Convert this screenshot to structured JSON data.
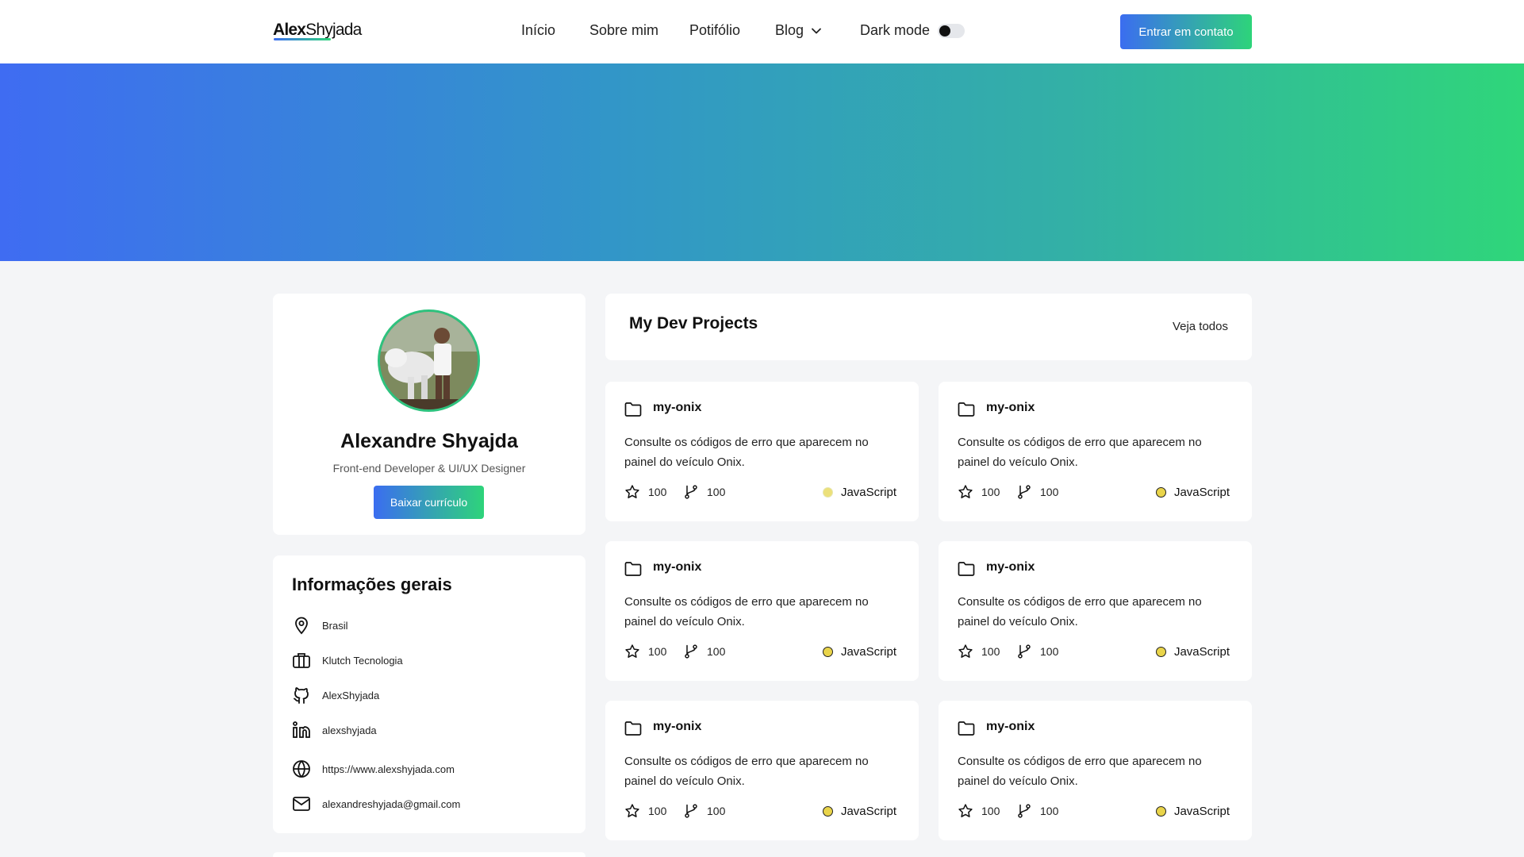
{
  "nav": {
    "logo_first": "Alex",
    "logo_last": "Shyjada",
    "links": [
      "Início",
      "Sobre mim",
      "Potifólio",
      "Blog"
    ],
    "dark_mode_label": "Dark mode",
    "cta_label": "Entrar em contato"
  },
  "profile": {
    "name": "Alexandre Shyajda",
    "role": "Front-end Developer & UI/UX Designer",
    "button_label": "Baixar currículo"
  },
  "info": {
    "title": "Informações gerais",
    "items": [
      {
        "icon": "location-pin-icon",
        "text": "Brasil"
      },
      {
        "icon": "briefcase-icon",
        "text": "Klutch Tecnologia"
      },
      {
        "icon": "github-icon",
        "text": "AlexShyjada"
      },
      {
        "icon": "linkedin-icon",
        "text": "alexshyjada"
      },
      {
        "icon": "globe-icon",
        "text": "https://www.alexshyjada.com"
      },
      {
        "icon": "mail-icon",
        "text": "alexandreshyjada@gmail.com"
      }
    ]
  },
  "projects": {
    "title": "My Dev Projects",
    "see_all": "Veja todos",
    "items": [
      {
        "name": "my-onix",
        "description": "Consulte os códigos de erro que aparecem no painel do veículo Onix.",
        "stars": "100",
        "forks": "100",
        "language": "JavaScript"
      },
      {
        "name": "my-onix",
        "description": "Consulte os códigos de erro que aparecem no painel do veículo Onix.",
        "stars": "100",
        "forks": "100",
        "language": "JavaScript"
      },
      {
        "name": "my-onix",
        "description": "Consulte os códigos de erro que aparecem no painel do veículo Onix.",
        "stars": "100",
        "forks": "100",
        "language": "JavaScript"
      },
      {
        "name": "my-onix",
        "description": "Consulte os códigos de erro que aparecem no painel do veículo Onix.",
        "stars": "100",
        "forks": "100",
        "language": "JavaScript"
      },
      {
        "name": "my-onix",
        "description": "Consulte os códigos de erro que aparecem no painel do veículo Onix.",
        "stars": "100",
        "forks": "100",
        "language": "JavaScript"
      },
      {
        "name": "my-onix",
        "description": "Consulte os códigos de erro que aparecem no painel do veículo Onix.",
        "stars": "100",
        "forks": "100",
        "language": "JavaScript"
      }
    ]
  },
  "colors": {
    "accent_start": "#3b6df0",
    "accent_end": "#2ed47a",
    "javascript_dot": "#e9d44a"
  }
}
